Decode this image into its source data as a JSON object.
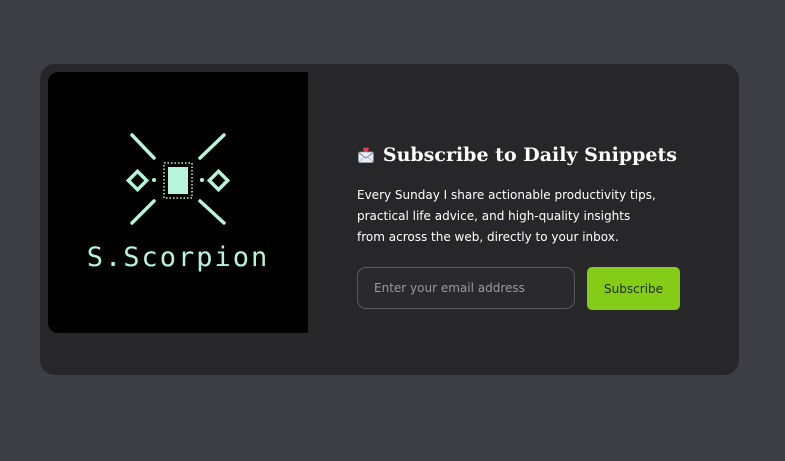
{
  "logo": {
    "brand_text": "S.Scorpion",
    "accent_color": "#b6f5dc",
    "icon": "chip-with-diamonds-icon"
  },
  "newsletter": {
    "icon": "envelope-with-heart-icon",
    "title": "Subscribe to Daily Snippets",
    "description": "Every Sunday I share actionable productivity tips, practical life advice, and high-quality insights from across the web, directly to your inbox.",
    "email_placeholder": "Enter your email address",
    "email_value": "",
    "subscribe_label": "Subscribe",
    "button_color": "#84cc16"
  }
}
